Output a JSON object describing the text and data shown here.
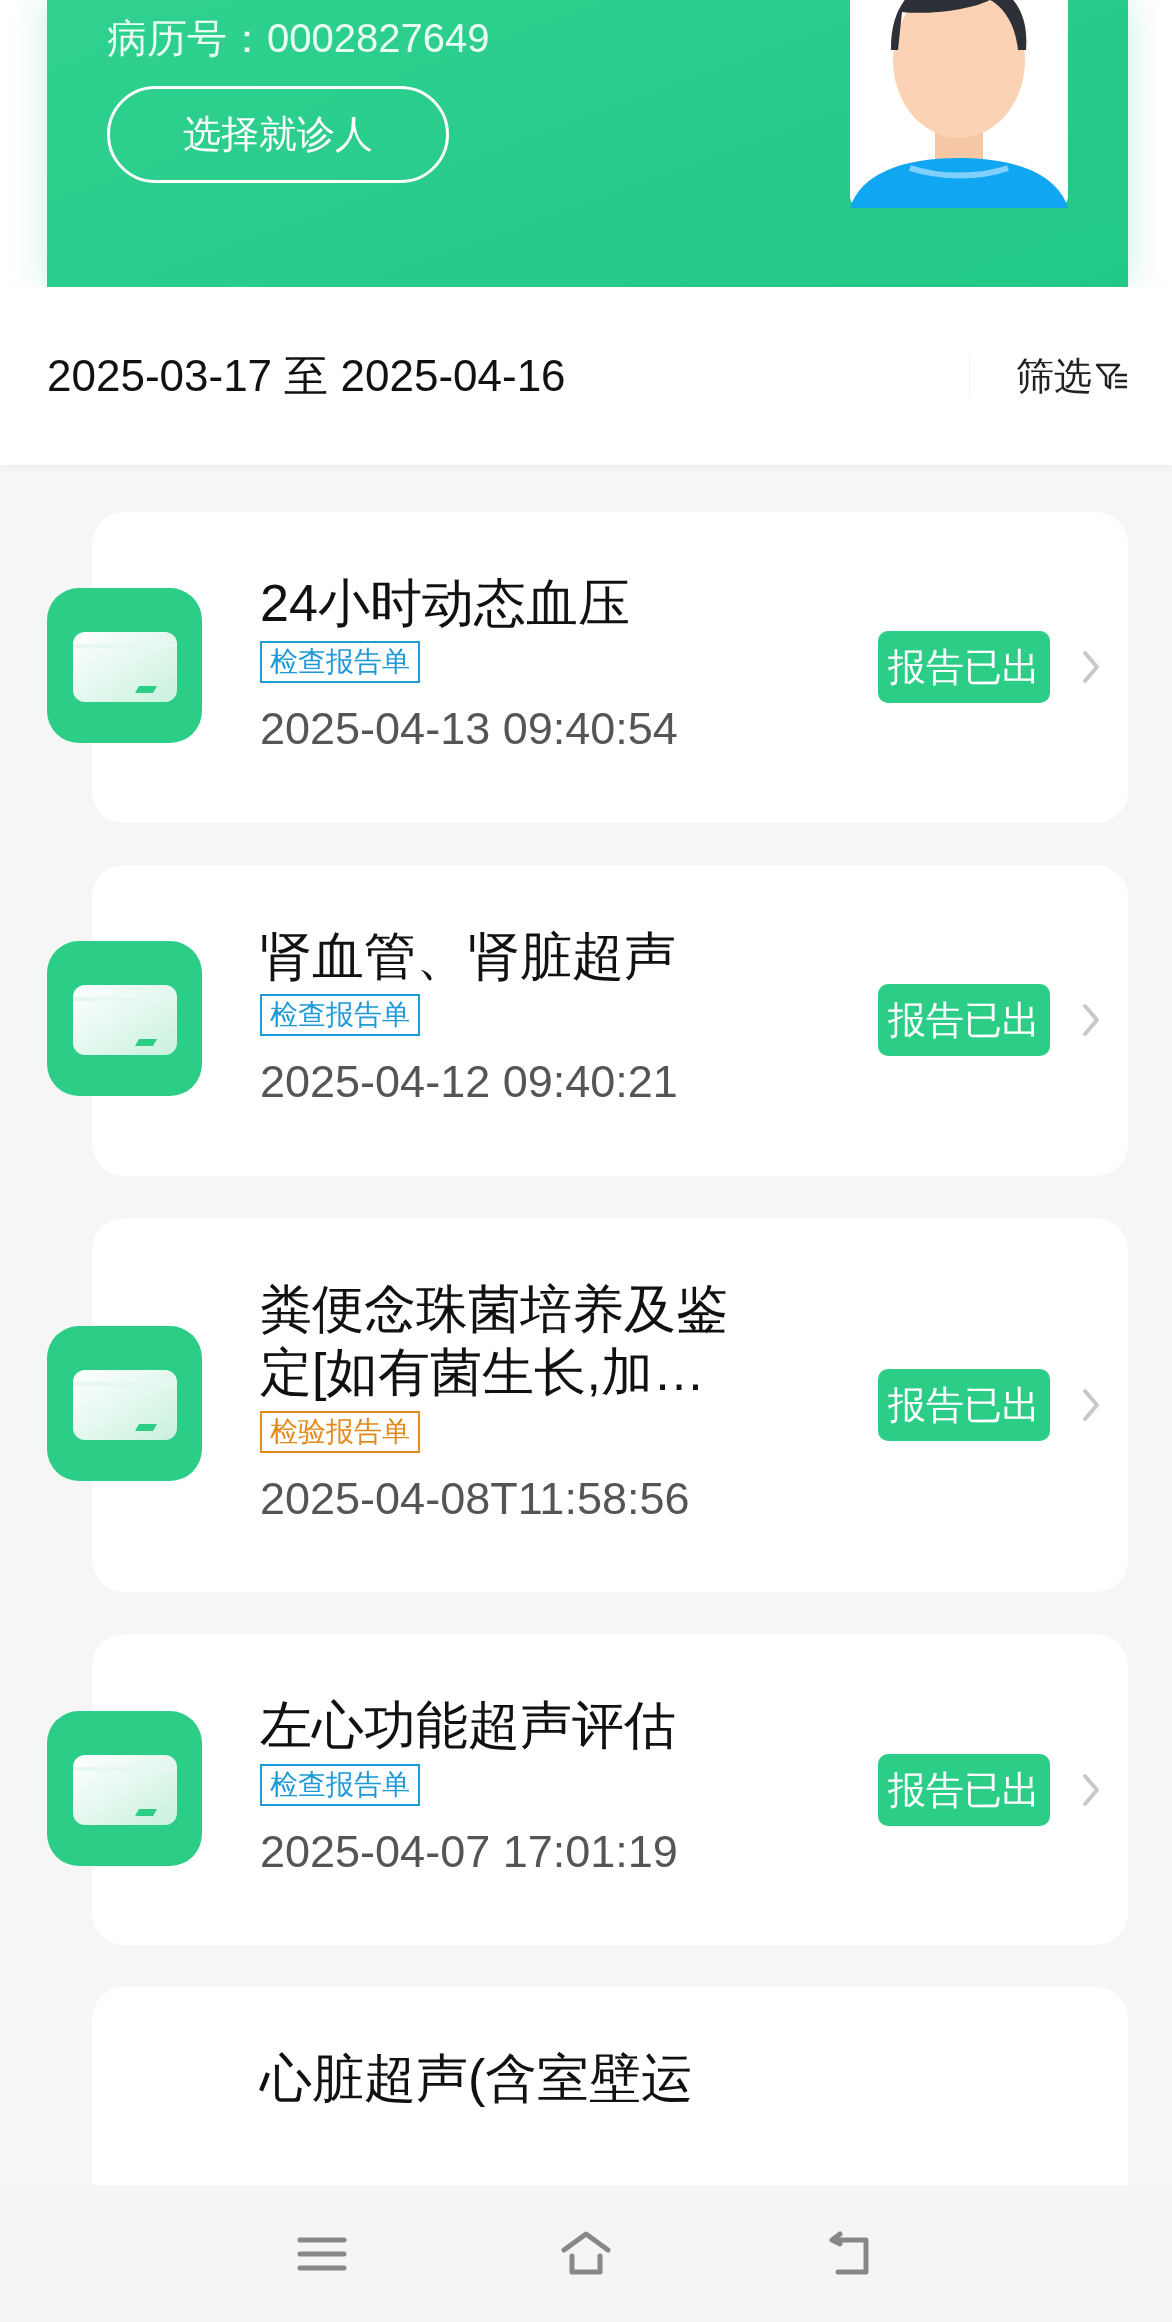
{
  "patient": {
    "record": "病历号：0002827649",
    "select_button": "选择就诊人"
  },
  "filter_bar": {
    "date_range": "2025-03-17 至 2025-04-16",
    "filter_label": "筛选"
  },
  "reports": [
    {
      "title": "24小时动态血压",
      "tag": {
        "text": "检查报告单",
        "color": "#1e9ad6"
      },
      "datetime": "2025-04-13 09:40:54",
      "status": "报告已出"
    },
    {
      "title": "肾血管、肾脏超声",
      "tag": {
        "text": "检查报告单",
        "color": "#1e9ad6"
      },
      "datetime": "2025-04-12 09:40:21",
      "status": "报告已出"
    },
    {
      "title": "粪便念珠菌培养及鉴定[如有菌生长,加…",
      "tag": {
        "text": "检验报告单",
        "color": "#e38a1c"
      },
      "datetime": "2025-04-08T11:58:56",
      "status": "报告已出"
    },
    {
      "title": "左心功能超声评估",
      "tag": {
        "text": "检查报告单",
        "color": "#1e9ad6"
      },
      "datetime": "2025-04-07 17:01:19",
      "status": "报告已出"
    },
    {
      "title": "心脏超声(含室壁运"
    }
  ]
}
